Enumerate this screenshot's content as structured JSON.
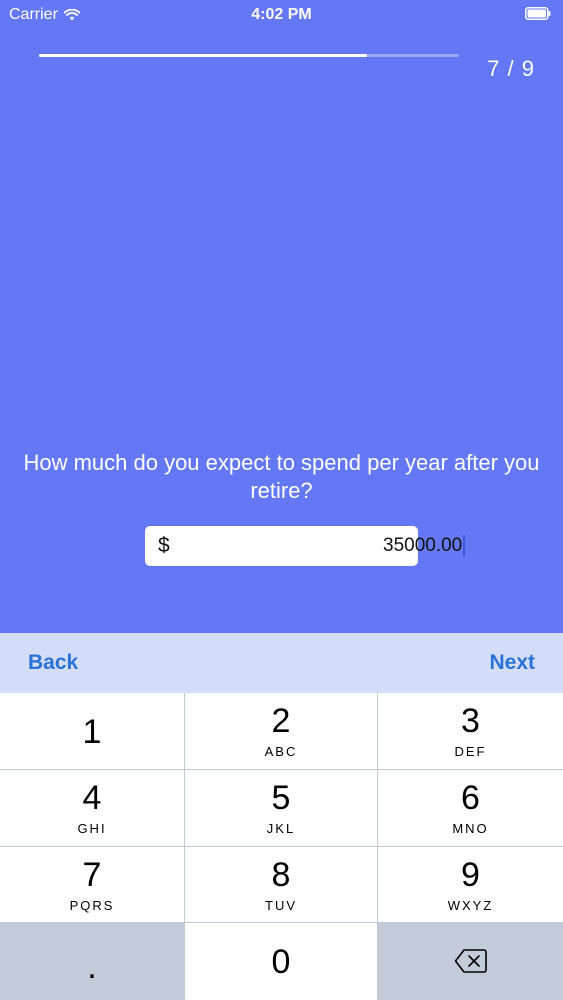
{
  "status_bar": {
    "carrier": "Carrier",
    "time": "4:02 PM",
    "wifi_icon": "wifi-icon",
    "battery_icon": "battery-icon"
  },
  "progress": {
    "step": "7 / 9",
    "fraction": 0.78
  },
  "question": {
    "text": "How much do you expect to spend per year after you retire?"
  },
  "amount": {
    "currency": "$",
    "value": "35000.00"
  },
  "toolbar": {
    "back_label": "Back",
    "next_label": "Next"
  },
  "keypad": {
    "keys": [
      {
        "digit": "1",
        "letters": ""
      },
      {
        "digit": "2",
        "letters": "ABC"
      },
      {
        "digit": "3",
        "letters": "DEF"
      },
      {
        "digit": "4",
        "letters": "GHI"
      },
      {
        "digit": "5",
        "letters": "JKL"
      },
      {
        "digit": "6",
        "letters": "MNO"
      },
      {
        "digit": "7",
        "letters": "PQRS"
      },
      {
        "digit": "8",
        "letters": "TUV"
      },
      {
        "digit": "9",
        "letters": "WXYZ"
      }
    ],
    "decimal": ".",
    "zero": "0",
    "backspace_icon": "backspace-icon"
  },
  "colors": {
    "background": "#6478f6",
    "toolbar": "#d3ddf7",
    "accent": "#2b72d8"
  }
}
